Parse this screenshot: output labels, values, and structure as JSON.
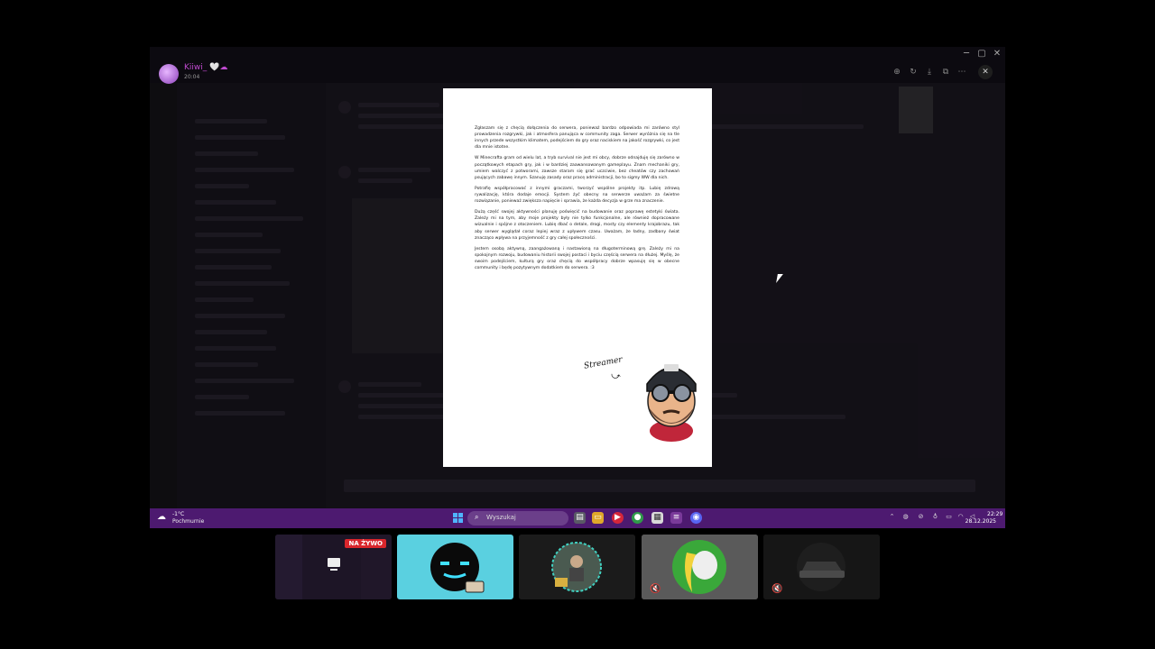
{
  "user": {
    "name": "Kiiwi_ 🤍☁",
    "time": "20:04"
  },
  "viewer_tools": [
    "zoom-icon",
    "rotate-icon",
    "download-icon",
    "open-external-icon",
    "more-icon"
  ],
  "close_label": "✕",
  "document": {
    "paragraphs": [
      "Zgłaszam się z chęcią dołączenia do serwera, ponieważ bardzo odpowiada mi zarówno styl prowadzenia rozgrywki, jak i atmosfera panująca w community zaga. Serwer wyróżnia się na tle innych przede wszystkim klimatem, podejściem do gry oraz naciskiem na jakość rozgrywki, co jest dla mnie istotne.",
      "W Minecrafta gram od wielu lat, a tryb survival nie jest mi obcy, dobrze odnajduję się zarówno w początkowych etapach gry, jak i w bardziej zaawansowanym gameplayu. Znam mechaniki gry, umiem walczyć z potworami, zawsze staram się grać uczciwie, bez cheatów czy zachowań psujących zabawę innym. Szanuję zasady oraz pracę administracji, bo to sigmy WW dla nich.",
      "Potrafię współpracować z innymi graczami, tworzyć wspólne projekty itp. Lubię zdrową rywalizację, która dodaje emocji. System żyć obecny na serwerze uważam za świetne rozwiązanie, ponieważ zwiększa napięcie i sprawia, że każda decyzja w grze ma znaczenie.",
      "Dużą część swojej aktywności planuję poświęcić na budowanie oraz poprawę estetyki świata. Zależy mi na tym, aby moje projekty były nie tylko funkcjonalne, ale również dopracowane wizualnie i spójne z otoczeniem. Lubię dbać o detale, drogi, mosty czy elementy krajobrazu, tak aby serwer wyglądał coraz lepiej wraz z upływem czasu. Uważam, że ładny, zadbany świat znacząco wpływa na przyjemność z gry całej społeczności.",
      "Jestem osobą aktywną, zaangażowaną i nastawioną na długoterminową grę. Zależy mi na spokojnym rozwoju, budowaniu historii swojej postaci i byciu częścią serwera na dłużej. Myślę, że swoim podejściem, kulturą gry oraz chęcią do współpracy dobrze wpasuję się w obecne community i będę pozytywnym dodatkiem do serwera. :3"
    ],
    "signature": "Streamer"
  },
  "taskbar": {
    "temperature": "-1°C",
    "condition": "Pochmurnie",
    "search_placeholder": "Wyszukaj",
    "apps": [
      "file-explorer-icon",
      "folder-icon",
      "media-player-icon",
      "chrome-icon",
      "photos-icon",
      "game-launcher-icon",
      "discord-icon"
    ],
    "tray": [
      "chevron-up-icon",
      "vpn-icon",
      "network-off-icon",
      "microphone-icon",
      "display-icon",
      "wifi-icon",
      "volume-icon"
    ],
    "time": "22:29",
    "date": "28.12.2025"
  },
  "call": {
    "live_label": "NA ŻYWO",
    "participants": [
      "screen-share",
      "glowing-mask",
      "person-seated",
      "banana-cat",
      "car"
    ],
    "active_index": 1
  }
}
